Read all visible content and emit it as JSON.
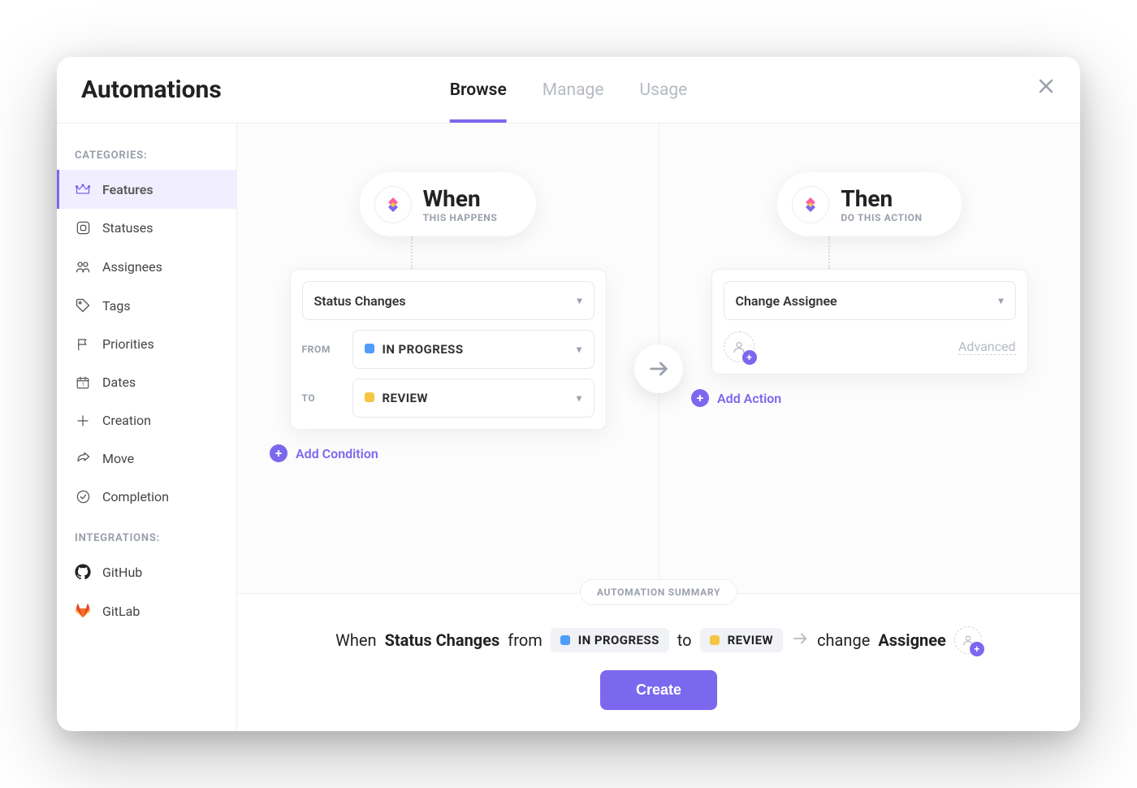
{
  "header": {
    "title": "Automations",
    "tabs": {
      "browse": "Browse",
      "manage": "Manage",
      "usage": "Usage"
    }
  },
  "sidebar": {
    "categories_heading": "CATEGORIES:",
    "integrations_heading": "INTEGRATIONS:",
    "items": [
      {
        "key": "features",
        "label": "Features"
      },
      {
        "key": "statuses",
        "label": "Statuses"
      },
      {
        "key": "assignees",
        "label": "Assignees"
      },
      {
        "key": "tags",
        "label": "Tags"
      },
      {
        "key": "priorities",
        "label": "Priorities"
      },
      {
        "key": "dates",
        "label": "Dates"
      },
      {
        "key": "creation",
        "label": "Creation"
      },
      {
        "key": "move",
        "label": "Move"
      },
      {
        "key": "completion",
        "label": "Completion"
      }
    ],
    "integrations": [
      {
        "key": "github",
        "label": "GitHub"
      },
      {
        "key": "gitlab",
        "label": "GitLab"
      }
    ]
  },
  "when": {
    "title": "When",
    "subtitle": "THIS HAPPENS",
    "trigger": "Status Changes",
    "from_label": "FROM",
    "from_status": {
      "name": "IN PROGRESS",
      "color": "#4f9cf9"
    },
    "to_label": "TO",
    "to_status": {
      "name": "REVIEW",
      "color": "#f5c543"
    },
    "add_condition": "Add Condition"
  },
  "then": {
    "title": "Then",
    "subtitle": "DO THIS ACTION",
    "action": "Change Assignee",
    "advanced_label": "Advanced",
    "add_action": "Add Action"
  },
  "summary": {
    "heading": "AUTOMATION SUMMARY",
    "when_word": "When",
    "trigger_bold": "Status Changes",
    "from_word": "from",
    "from_chip": {
      "name": "IN PROGRESS",
      "color": "#4f9cf9"
    },
    "to_word": "to",
    "to_chip": {
      "name": "REVIEW",
      "color": "#f5c543"
    },
    "change_word": "change",
    "action_bold": "Assignee",
    "create_label": "Create"
  },
  "colors": {
    "accent": "#7b68ee"
  }
}
